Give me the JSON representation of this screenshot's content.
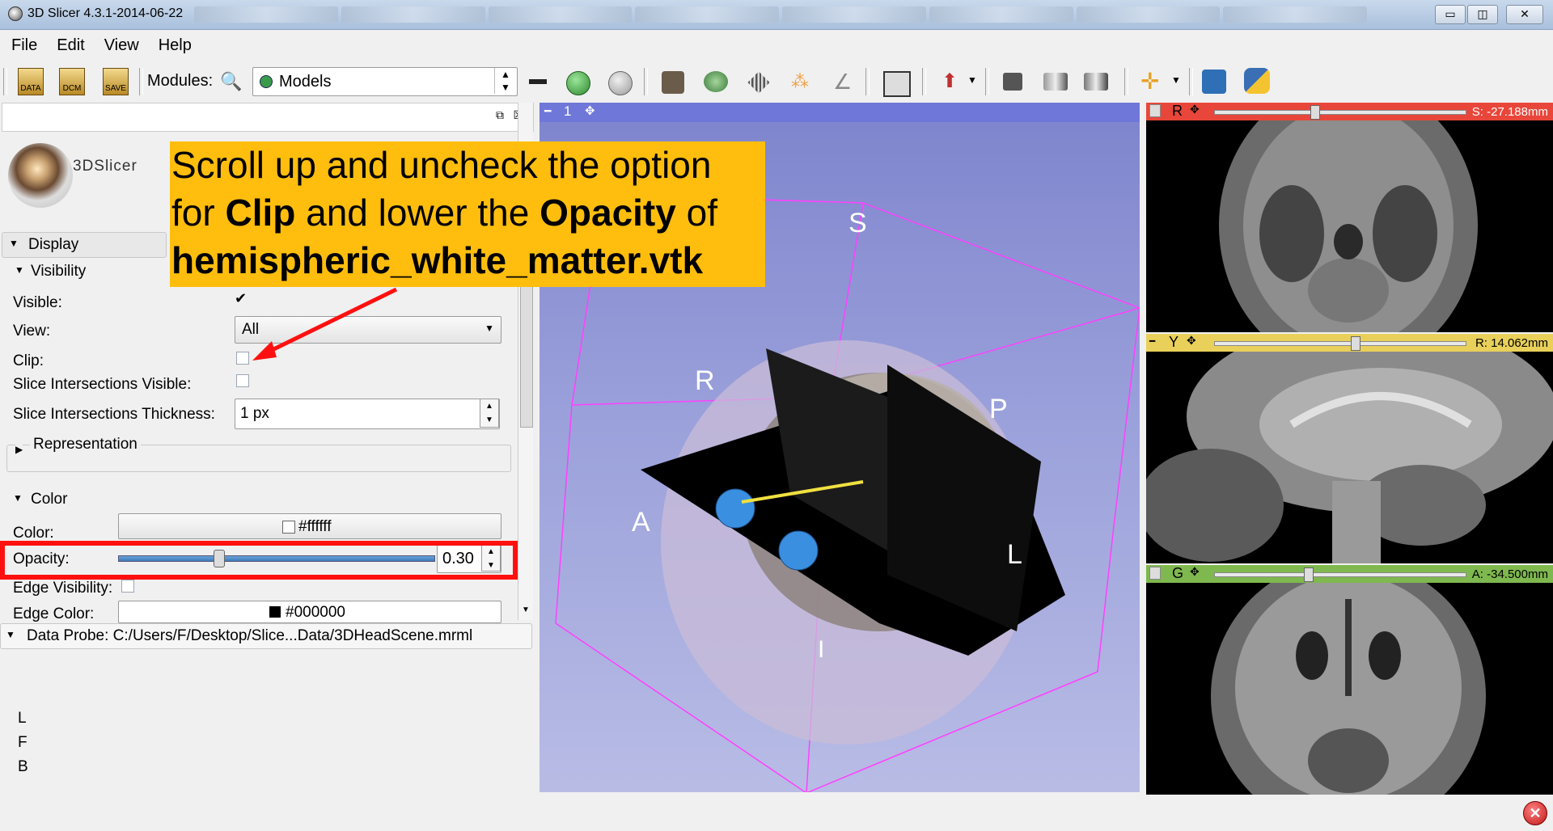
{
  "window": {
    "title": "3D Slicer 4.3.1-2014-06-22",
    "controls": [
      "▭",
      "◫",
      "✕"
    ]
  },
  "menu": [
    "File",
    "Edit",
    "View",
    "Help"
  ],
  "toolbar": {
    "buttons": [
      "DATA",
      "DCM",
      "SAVE"
    ],
    "modules_label": "Modules:",
    "module_selected": "Models",
    "view_label": "1"
  },
  "panel": {
    "logo_text": "3DSlicer",
    "display_section": "Display",
    "visibility_section": "Visibility",
    "visible_label": "Visible:",
    "visible_checked": true,
    "view_label": "View:",
    "view_value": "All",
    "clip_label": "Clip:",
    "clip_checked": false,
    "slice_intersections_visible_label": "Slice Intersections Visible:",
    "slice_intersections_thickness_label": "Slice Intersections Thickness:",
    "slice_intersections_thickness_value": "1 px",
    "representation_section": "Representation",
    "color_section": "Color",
    "color_label": "Color:",
    "color_value": "#ffffff",
    "opacity_label": "Opacity:",
    "opacity_value": "0.30",
    "opacity_fraction": 0.3,
    "edge_visibility_label": "Edge Visibility:",
    "edge_color_label": "Edge Color:",
    "edge_color_value": "#000000",
    "data_probe": "Data Probe: C:/Users/F/Desktop/Slice...Data/3DHeadScene.mrml",
    "probe_lines": [
      "L",
      "F",
      "B"
    ]
  },
  "view3d": {
    "axis_labels": {
      "S": "S",
      "R": "R",
      "P": "P",
      "A": "A",
      "L": "L",
      "I": "I"
    }
  },
  "slices": [
    {
      "name": "R",
      "color": "#e8463a",
      "readout": "S: -27.188mm",
      "slider": 0.38
    },
    {
      "name": "Y",
      "color": "#e8d05a",
      "readout": "R: 14.062mm",
      "slider": 0.55
    },
    {
      "name": "G",
      "color": "#7fb84e",
      "readout": "A: -34.500mm",
      "slider": 0.36
    }
  ],
  "callout": {
    "line1": "Scroll up and uncheck the option",
    "line2_pre": "for ",
    "line2_bold1": "Clip",
    "line2_mid": " and lower the ",
    "line2_bold2": "Opacity",
    "line2_post": " of",
    "line3": "hemispheric_white_matter.vtk"
  },
  "colors": {
    "highlight": "#ff1010",
    "callout_bg": "#ffbe0d",
    "view3d_header": "#6f77d8"
  }
}
